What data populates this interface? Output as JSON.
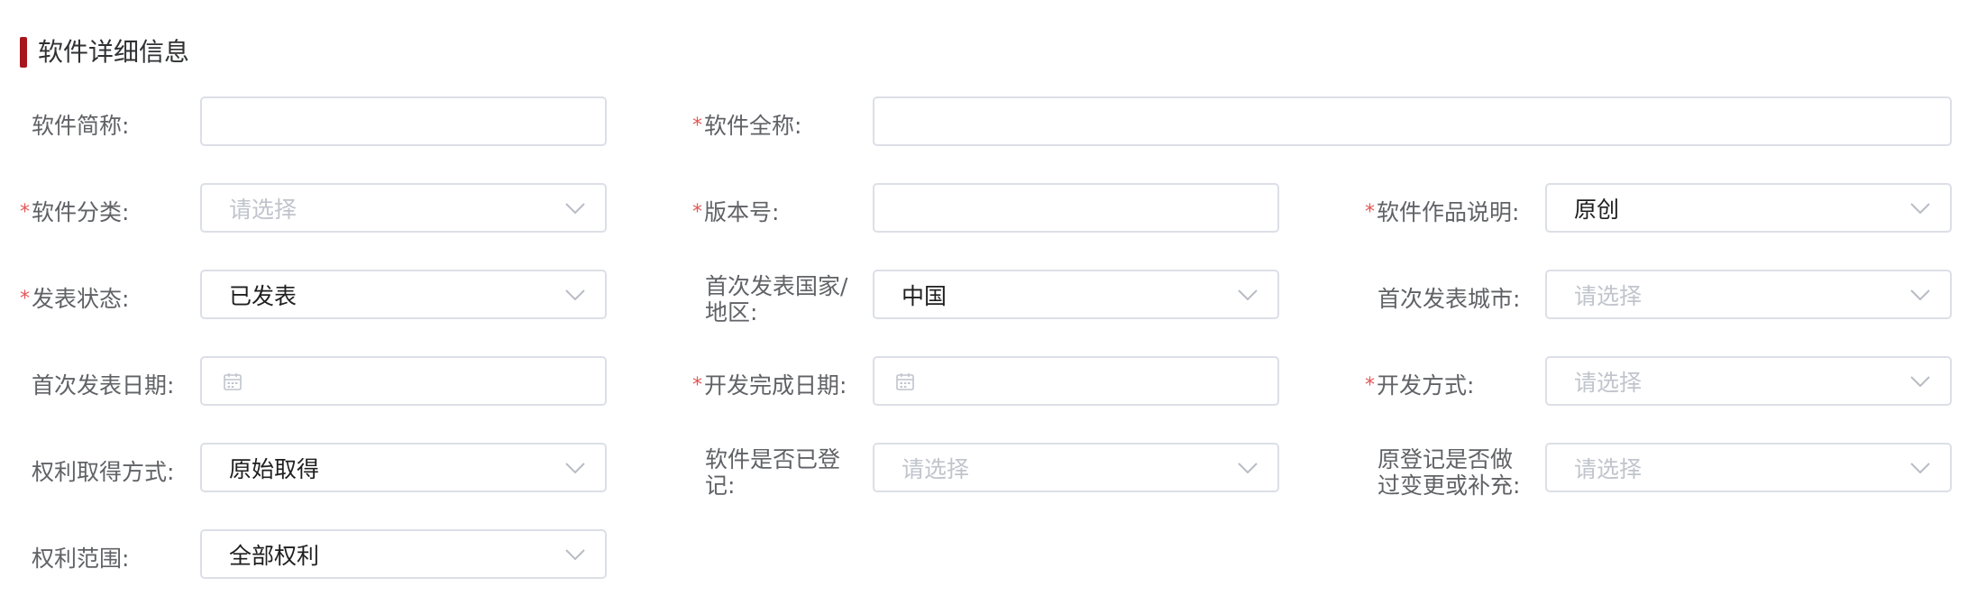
{
  "section": {
    "title": "软件详细信息",
    "accent_color": "#a8161d"
  },
  "required_mark": "*",
  "fields": {
    "short_name": {
      "label": "软件简称:",
      "value": ""
    },
    "full_name": {
      "label": "软件全称:",
      "required": true,
      "value": ""
    },
    "category": {
      "label": "软件分类:",
      "required": true,
      "placeholder": "请选择",
      "value": ""
    },
    "version": {
      "label": "版本号:",
      "required": true,
      "value": ""
    },
    "work_desc": {
      "label": "软件作品说明:",
      "required": true,
      "value": "原创"
    },
    "publish_status": {
      "label": "发表状态:",
      "required": true,
      "value": "已发表"
    },
    "first_country": {
      "label": "首次发表国家/地区:",
      "value": "中国"
    },
    "first_city": {
      "label": "首次发表城市:",
      "placeholder": "请选择",
      "value": ""
    },
    "first_date": {
      "label": "首次发表日期:",
      "icon": "calendar-icon",
      "value": ""
    },
    "dev_done_date": {
      "label": "开发完成日期:",
      "required": true,
      "icon": "calendar-icon",
      "value": ""
    },
    "dev_method": {
      "label": "开发方式:",
      "required": true,
      "placeholder": "请选择",
      "value": ""
    },
    "rights_method": {
      "label": "权利取得方式:",
      "value": "原始取得"
    },
    "registered": {
      "label": "软件是否已登记:",
      "placeholder": "请选择",
      "value": ""
    },
    "original_changed": {
      "label": "原登记是否做过变更或补充:",
      "placeholder": "请选择",
      "value": ""
    },
    "rights_scope": {
      "label": "权利范围:",
      "value": "全部权利"
    }
  }
}
